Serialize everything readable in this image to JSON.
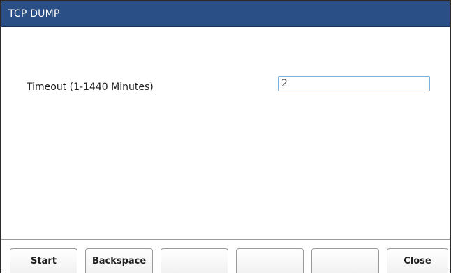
{
  "window": {
    "title": "TCP DUMP"
  },
  "form": {
    "timeout_label": "Timeout (1-1440 Minutes)",
    "timeout_value": "2"
  },
  "softkeys": {
    "k1": "Start",
    "k2": "Backspace",
    "k3": "",
    "k4": "",
    "k5": "",
    "k6": "Close"
  },
  "colors": {
    "titlebar": "#2a4f86",
    "input_border": "#7db0dd"
  }
}
